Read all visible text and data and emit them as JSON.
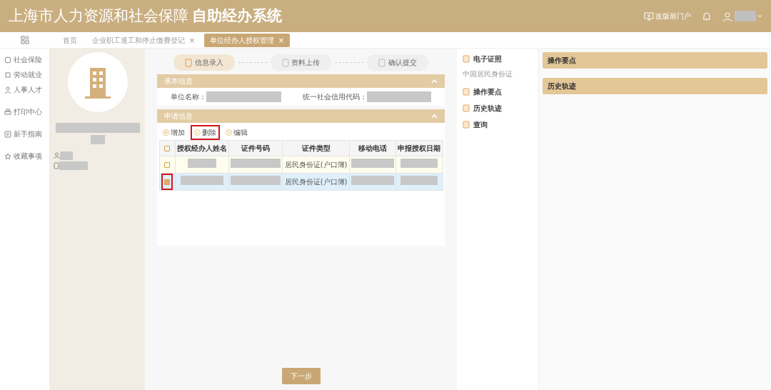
{
  "header": {
    "title": "上海市人力资源和社会保障",
    "subtitle": "自助经办系统",
    "portal_link": "改版前门户"
  },
  "nav_groups": [
    {
      "items": [
        "社会保险",
        "劳动就业",
        "人事人才"
      ]
    },
    {
      "items": [
        "打印中心"
      ]
    },
    {
      "items": [
        "新手指南"
      ]
    },
    {
      "items": [
        "收藏事项"
      ]
    }
  ],
  "tabs": [
    {
      "label": "首页",
      "selected": false
    },
    {
      "label": "企业职工退工和停止缴费登记",
      "close": "×",
      "selected": false
    },
    {
      "label": "单位经办人授权管理",
      "close": "×",
      "selected": true
    }
  ],
  "steps": [
    {
      "label": "信息录入",
      "active": true
    },
    {
      "label": "资料上传",
      "active": false
    },
    {
      "label": "确认提交",
      "active": false
    }
  ],
  "basic_info": {
    "title": "基本信息",
    "fields": [
      "单位名称：",
      "统一社会信用代码："
    ]
  },
  "apply_info": {
    "title": "申请信息",
    "toolbar": [
      {
        "label": "增加",
        "kind": "add",
        "annotated": false
      },
      {
        "label": "删除",
        "kind": "remove",
        "annotated": true
      },
      {
        "label": "编辑",
        "kind": "edit",
        "annotated": false
      }
    ],
    "select_all_checked": false,
    "columns": [
      "授权经办人姓名",
      "证件号码",
      "证件类型",
      "移动电话",
      "申报授权日期"
    ],
    "rows": [
      {
        "selected": false,
        "checked": false,
        "annotated": false,
        "id_type": "居民身份证(户口簿)"
      },
      {
        "selected": true,
        "checked": true,
        "annotated": true,
        "id_type": "居民身份证(户口簿)"
      }
    ]
  },
  "next_button": "下一步",
  "side_menu": [
    {
      "label": "电子证照",
      "sub": "中国居民身份证"
    },
    {
      "label": "操作要点"
    },
    {
      "label": "历史轨迹"
    },
    {
      "label": "查询"
    }
  ],
  "right_panels": [
    "操作要点",
    "历史轨迹"
  ]
}
